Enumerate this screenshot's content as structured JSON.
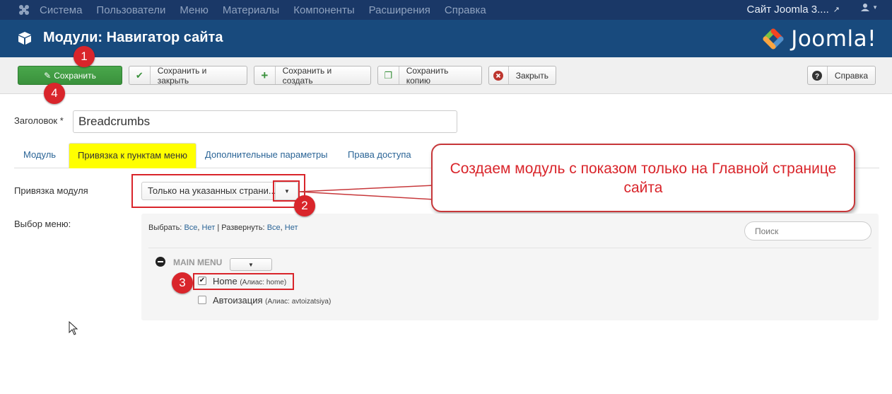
{
  "topnav": {
    "menu": [
      "Система",
      "Пользователи",
      "Меню",
      "Материалы",
      "Компоненты",
      "Расширения",
      "Справка"
    ],
    "site_label": "Сайт Joomla 3...."
  },
  "header": {
    "title": "Модули: Навигатор сайта",
    "brand": "Joomla!"
  },
  "toolbar": {
    "save": "Сохранить",
    "save_close": "Сохранить и закрыть",
    "save_new": "Сохранить и создать",
    "save_copy": "Сохранить копию",
    "close": "Закрыть",
    "help": "Справка"
  },
  "form": {
    "title_label": "Заголовок *",
    "title_value": "Breadcrumbs",
    "tabs": [
      "Модуль",
      "Привязка к пунктам меню",
      "Дополнительные параметры",
      "Права доступа"
    ],
    "assignment_label": "Привязка модуля",
    "assignment_value": "Только на указанных страни...",
    "menu_select_label": "Выбор меню:"
  },
  "tree": {
    "select_label": "Выбрать:",
    "all": "Все",
    "none": "Нет",
    "expand_label": "Развернуть:",
    "search_placeholder": "Поиск",
    "menu_title": "MAIN MENU",
    "items": [
      {
        "name": "Home",
        "alias": "(Алиас: home)",
        "checked": true
      },
      {
        "name": "Автоизация",
        "alias": "(Алиас: avtoizatsiya)",
        "checked": false
      }
    ]
  },
  "annotations": {
    "badges": [
      "1",
      "2",
      "3",
      "4"
    ],
    "callout": "Создаем модуль с показом только на Главной странице сайта"
  },
  "colors": {
    "topnav_bg": "#1a3867",
    "header_bg": "#184a7d",
    "save_green": "#3a913c",
    "annotation_red": "#d9252b",
    "tab_highlight": "#ffff00"
  }
}
